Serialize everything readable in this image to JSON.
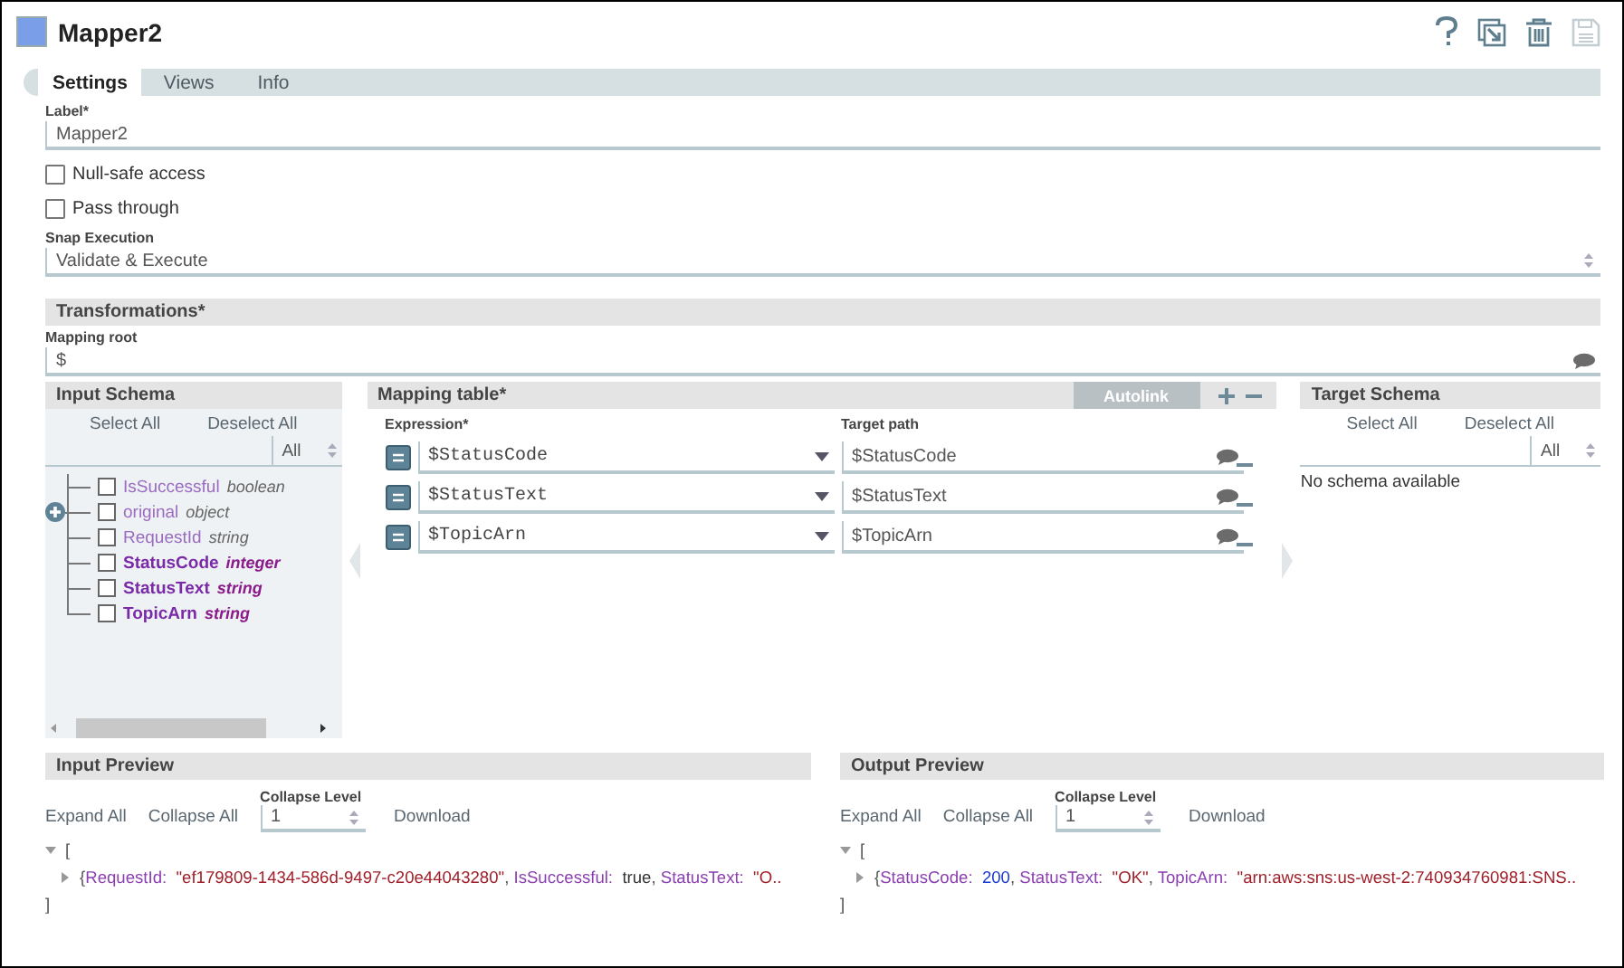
{
  "window": {
    "title": "Mapper2"
  },
  "tabs": [
    {
      "label": "Settings",
      "selected": true
    },
    {
      "label": "Views",
      "selected": false
    },
    {
      "label": "Info",
      "selected": false
    }
  ],
  "label_field": {
    "label": "Label*",
    "value": "Mapper2"
  },
  "options": [
    {
      "label": "Null-safe access",
      "checked": false
    },
    {
      "label": "Pass through",
      "checked": false
    }
  ],
  "snap_execution": {
    "label": "Snap Execution",
    "value": "Validate & Execute"
  },
  "transformations": {
    "title": "Transformations*",
    "mapping_root": {
      "label": "Mapping root",
      "value": "$"
    }
  },
  "input_schema": {
    "title": "Input Schema",
    "actions": [
      "Select All",
      "Deselect All"
    ],
    "filter": "All",
    "items": [
      {
        "name": "IsSuccessful",
        "type": "boolean",
        "mapped": false,
        "expandable": false,
        "checked": false
      },
      {
        "name": "original",
        "type": "object",
        "mapped": false,
        "expandable": true,
        "checked": false
      },
      {
        "name": "RequestId",
        "type": "string",
        "mapped": false,
        "expandable": false,
        "checked": false
      },
      {
        "name": "StatusCode",
        "type": "integer",
        "mapped": true,
        "expandable": false,
        "checked": false
      },
      {
        "name": "StatusText",
        "type": "string",
        "mapped": true,
        "expandable": false,
        "checked": false
      },
      {
        "name": "TopicArn",
        "type": "string",
        "mapped": true,
        "expandable": false,
        "checked": false
      }
    ]
  },
  "mapping_table": {
    "title": "Mapping table*",
    "autolink": {
      "label": "Autolink",
      "disabled": true
    },
    "expression_label": "Expression*",
    "target_label": "Target path",
    "rows": [
      {
        "expression": "$StatusCode",
        "target": "$StatusCode"
      },
      {
        "expression": "$StatusText",
        "target": "$StatusText"
      },
      {
        "expression": "$TopicArn",
        "target": "$TopicArn"
      }
    ]
  },
  "target_schema": {
    "title": "Target Schema",
    "actions": [
      "Select All",
      "Deselect All"
    ],
    "filter": "All",
    "message": "No schema available"
  },
  "previews": [
    {
      "title": "Input Preview",
      "actions": [
        "Expand All",
        "Collapse All"
      ],
      "collapse_label": "Collapse Level",
      "collapse_value": "1",
      "download": "Download",
      "lines": [
        {
          "kind": "toggle",
          "expanded": true,
          "tokens": [
            {
              "kind": "punct",
              "text": "["
            }
          ]
        },
        {
          "kind": "toggle",
          "expanded": false,
          "tokens": [
            {
              "kind": "punct",
              "text": "{"
            },
            {
              "kind": "key",
              "text": "RequestId:"
            },
            {
              "kind": "string",
              "text": "  \"ef179809-1434-586d-9497-c20e44043280\""
            },
            {
              "kind": "punct",
              "text": ", "
            },
            {
              "kind": "key",
              "text": "IsSuccessful:"
            },
            {
              "kind": "literal",
              "text": "  true"
            },
            {
              "kind": "punct",
              "text": ", "
            },
            {
              "kind": "key",
              "text": "StatusText:"
            },
            {
              "kind": "string",
              "text": "  \"O.."
            }
          ]
        },
        {
          "kind": "plain",
          "tokens": [
            {
              "kind": "punct",
              "text": "]"
            }
          ]
        }
      ]
    },
    {
      "title": "Output Preview",
      "actions": [
        "Expand All",
        "Collapse All"
      ],
      "collapse_label": "Collapse Level",
      "collapse_value": "1",
      "download": "Download",
      "lines": [
        {
          "kind": "toggle",
          "expanded": true,
          "tokens": [
            {
              "kind": "punct",
              "text": "["
            }
          ]
        },
        {
          "kind": "toggle",
          "expanded": false,
          "tokens": [
            {
              "kind": "punct",
              "text": "{"
            },
            {
              "kind": "key",
              "text": "StatusCode:"
            },
            {
              "kind": "number",
              "text": "  200"
            },
            {
              "kind": "punct",
              "text": ", "
            },
            {
              "kind": "key",
              "text": "StatusText:"
            },
            {
              "kind": "string",
              "text": "  \"OK\""
            },
            {
              "kind": "punct",
              "text": ", "
            },
            {
              "kind": "key",
              "text": "TopicArn:"
            },
            {
              "kind": "string",
              "text": "  \"arn:aws:sns:us-west-2:740934760981:SNS.."
            }
          ]
        },
        {
          "kind": "plain",
          "tokens": [
            {
              "kind": "punct",
              "text": "]"
            }
          ]
        }
      ]
    }
  ]
}
